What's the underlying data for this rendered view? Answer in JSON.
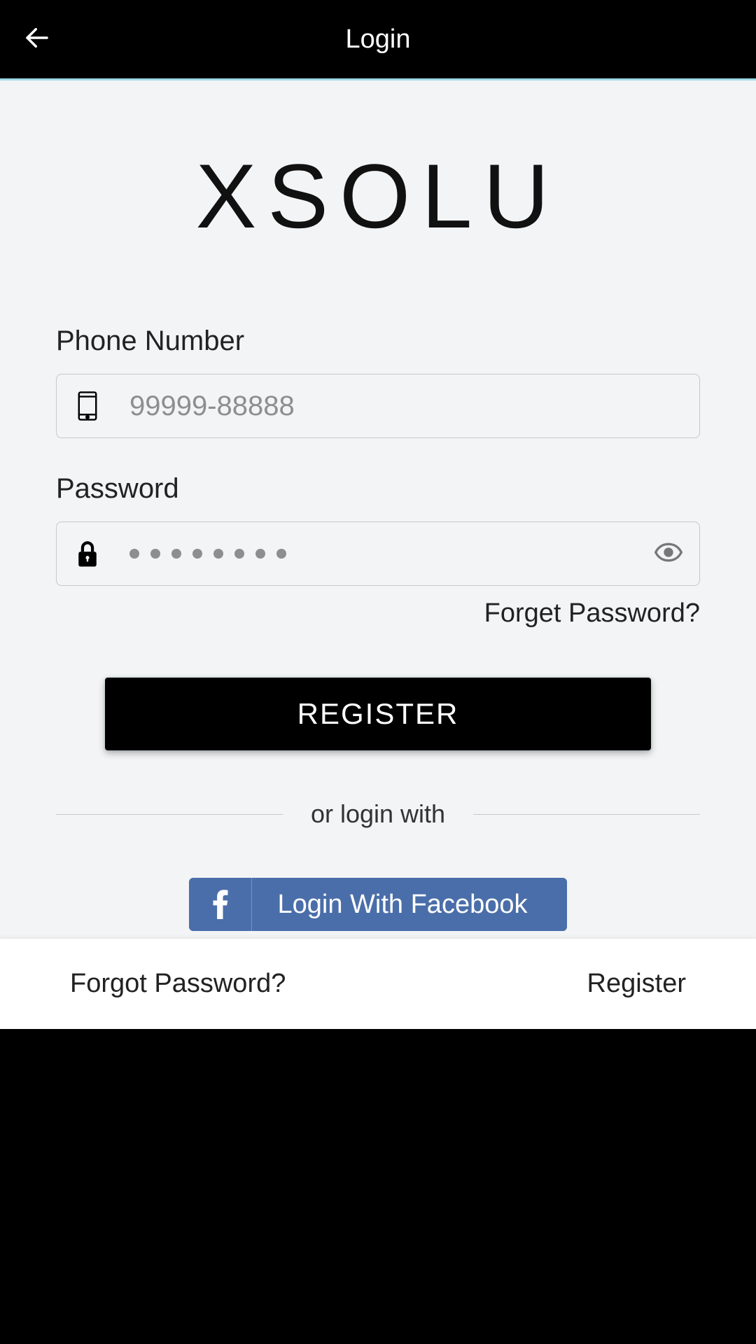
{
  "header": {
    "title": "Login"
  },
  "brand": {
    "name": "XSOLU"
  },
  "fields": {
    "phone": {
      "label": "Phone Number",
      "placeholder": "99999-88888"
    },
    "password": {
      "label": "Password",
      "mask_length": 8
    }
  },
  "links": {
    "forget": "Forget Password?"
  },
  "buttons": {
    "register": "REGISTER",
    "facebook": "Login With Facebook"
  },
  "divider": {
    "text": "or login with"
  },
  "footer": {
    "forgot": "Forgot Password?",
    "register": "Register"
  }
}
